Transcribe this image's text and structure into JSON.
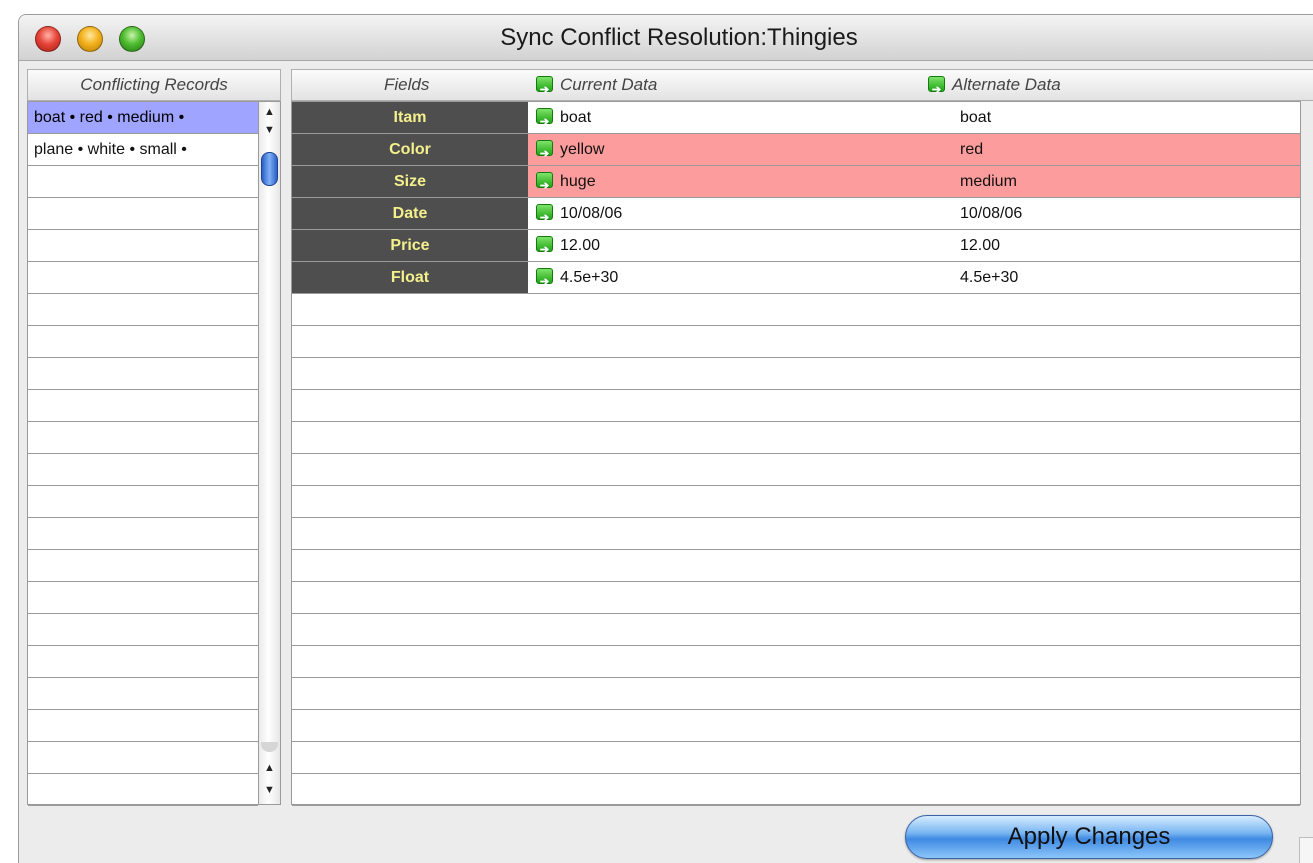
{
  "window": {
    "title": "Sync Conflict Resolution:Thingies"
  },
  "left_panel": {
    "header": "Conflicting Records",
    "records": [
      "boat • red • medium •",
      "plane • white • small •"
    ],
    "empty_rows": 20
  },
  "table": {
    "headers": {
      "fields": "Fields",
      "current": "Current Data",
      "alternate": "Alternate Data"
    },
    "rows": [
      {
        "field": "Itam",
        "current": "boat",
        "alternate": "boat",
        "conflict": false
      },
      {
        "field": "Color",
        "current": "yellow",
        "alternate": "red",
        "conflict": true
      },
      {
        "field": "Size",
        "current": "huge",
        "alternate": "medium",
        "conflict": true
      },
      {
        "field": "Date",
        "current": "10/08/06",
        "alternate": "10/08/06",
        "conflict": false
      },
      {
        "field": "Price",
        "current": "12.00",
        "alternate": "12.00",
        "conflict": false
      },
      {
        "field": "Float",
        "current": "4.5e+30",
        "alternate": "4.5e+30",
        "conflict": false
      }
    ],
    "empty_rows": 16
  },
  "apply_button": {
    "label": "Apply Changes"
  },
  "colors": {
    "selected_row": "#9ea4ff",
    "conflict_cell": "#fc9c9c",
    "field_cell_bg": "#4e4e4e",
    "field_cell_text": "#f4f08c",
    "apply_button": "#3f8ae2"
  },
  "icons": {
    "close": "close-icon",
    "minimize": "minimize-icon",
    "zoom": "zoom-icon",
    "copy_arrow": "green-arrow-icon"
  }
}
